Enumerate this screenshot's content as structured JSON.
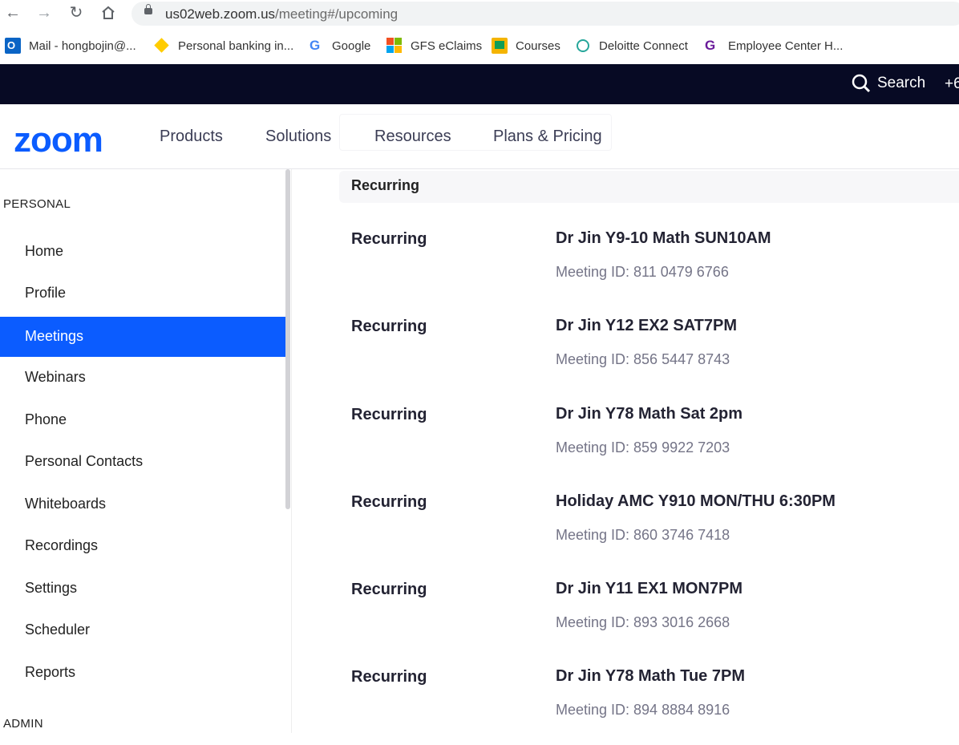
{
  "browser": {
    "url_host": "us02web.zoom.us",
    "url_path": "/meeting#/upcoming"
  },
  "bookmarks": [
    {
      "label": "Mail - hongbojin@...",
      "icon": "outlook-icon"
    },
    {
      "label": "Personal banking in...",
      "icon": "commbank-icon"
    },
    {
      "label": "Google",
      "icon": "google-icon"
    },
    {
      "label": "GFS eClaims",
      "icon": "microsoft-icon"
    },
    {
      "label": "Courses",
      "icon": "classroom-icon"
    },
    {
      "label": "Deloitte Connect",
      "icon": "deloitte-icon"
    },
    {
      "label": "Employee Center H...",
      "icon": "servicenow-icon"
    }
  ],
  "header": {
    "search_label": "Search",
    "phone_fragment": "+6",
    "logo": "zoom",
    "nav": [
      "Products",
      "Solutions",
      "Resources",
      "Plans & Pricing"
    ]
  },
  "sidebar": {
    "personal_title": "PERSONAL",
    "items": [
      "Home",
      "Profile",
      "Meetings",
      "Webinars",
      "Phone",
      "Personal Contacts",
      "Whiteboards",
      "Recordings",
      "Settings",
      "Scheduler",
      "Reports"
    ],
    "active": "Meetings",
    "admin_title": "ADMIN"
  },
  "content": {
    "group_header": "Recurring",
    "meetings": [
      {
        "kind": "Recurring",
        "title": "Dr Jin Y9-10 Math SUN10AM",
        "meeting_id": "Meeting ID: 811 0479 6766"
      },
      {
        "kind": "Recurring",
        "title": "Dr Jin Y12 EX2 SAT7PM",
        "meeting_id": "Meeting ID: 856 5447 8743"
      },
      {
        "kind": "Recurring",
        "title": "Dr Jin Y78 Math Sat 2pm",
        "meeting_id": "Meeting ID: 859 9922 7203"
      },
      {
        "kind": "Recurring",
        "title": "Holiday AMC Y910 MON/THU 6:30PM",
        "meeting_id": "Meeting ID: 860 3746 7418"
      },
      {
        "kind": "Recurring",
        "title": "Dr Jin Y11 EX1 MON7PM",
        "meeting_id": "Meeting ID: 893 3016 2668"
      },
      {
        "kind": "Recurring",
        "title": "Dr Jin Y78 Math Tue 7PM",
        "meeting_id": "Meeting ID: 894 8884 8916"
      }
    ]
  },
  "colors": {
    "accent": "#0b5cff",
    "topstrip": "#070a24"
  }
}
